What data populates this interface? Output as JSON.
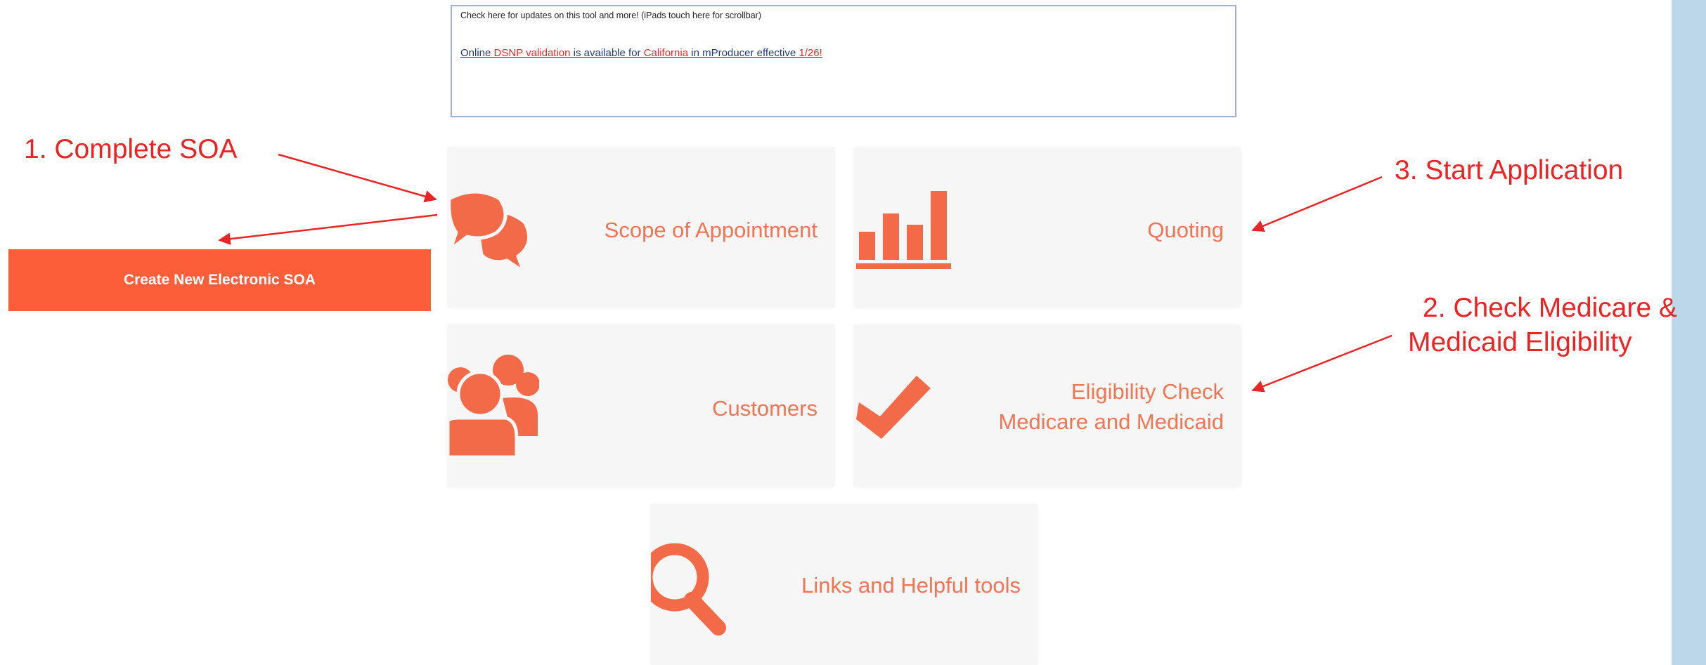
{
  "updates": {
    "header": "Check here for updates on this tool and more! (iPads touch here for scrollbar)",
    "notice": {
      "p1": "Online ",
      "p2": "DSNP validation",
      "p3": " is available for ",
      "p4": "California",
      "p5": " in mProducer effective ",
      "p6": "1/26",
      "p7": "!"
    }
  },
  "tiles": {
    "scope": "Scope of Appointment",
    "quoting": "Quoting",
    "customers": "Customers",
    "eligibility_line1": "Eligibility Check",
    "eligibility_line2": "Medicare and Medicaid",
    "links": "Links and Helpful tools"
  },
  "create_button": "Create New Electronic SOA",
  "annotations": {
    "step1": "1. Complete SOA",
    "step2_line1": "2. Check Medicare &",
    "step2_line2": "Medicaid Eligibility",
    "step3": "3. Start Application"
  },
  "colors": {
    "accent": "#fc5e3a",
    "icon": "#f26a48",
    "annotation": "#ea2424",
    "tile_bg": "#f6f6f6",
    "side_strip": "#bcd6ea"
  }
}
